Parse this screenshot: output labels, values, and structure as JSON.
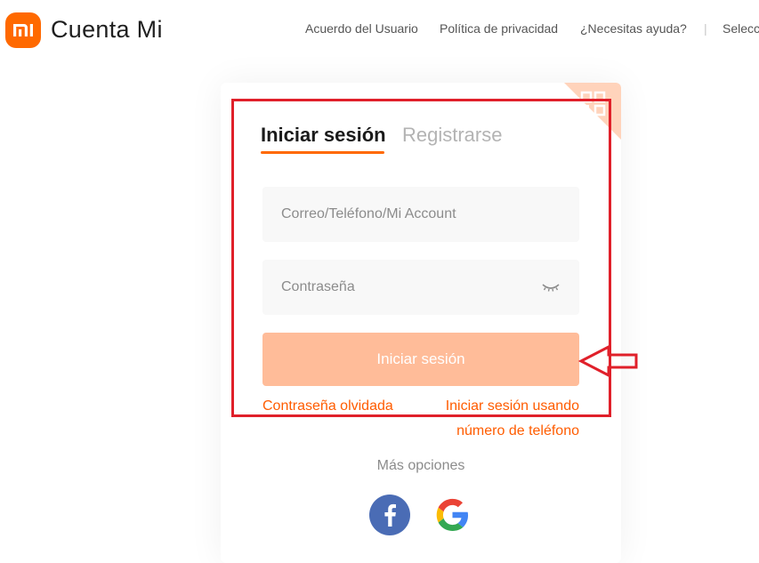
{
  "header": {
    "brand": "Cuenta Mi",
    "logo_text": "mi",
    "nav": [
      "Acuerdo del Usuario",
      "Política de privacidad",
      "¿Necesitas ayuda?",
      "|",
      "Selecc"
    ]
  },
  "login": {
    "tabs": {
      "login": "Iniciar sesión",
      "register": "Registrarse"
    },
    "account_placeholder": "Correo/Teléfono/Mi Account",
    "password_placeholder": "Contraseña",
    "submit_label": "Iniciar sesión",
    "forgot_link": "Contraseña olvidada",
    "phone_login_link": "Iniciar sesión usando número de teléfono",
    "more_options": "Más opciones",
    "social": [
      "facebook-icon",
      "google-icon"
    ]
  },
  "colors": {
    "brand": "#ff6900",
    "button_disabled": "#ffbc99",
    "link": "#ff5c00",
    "annotation": "#e0202a"
  }
}
